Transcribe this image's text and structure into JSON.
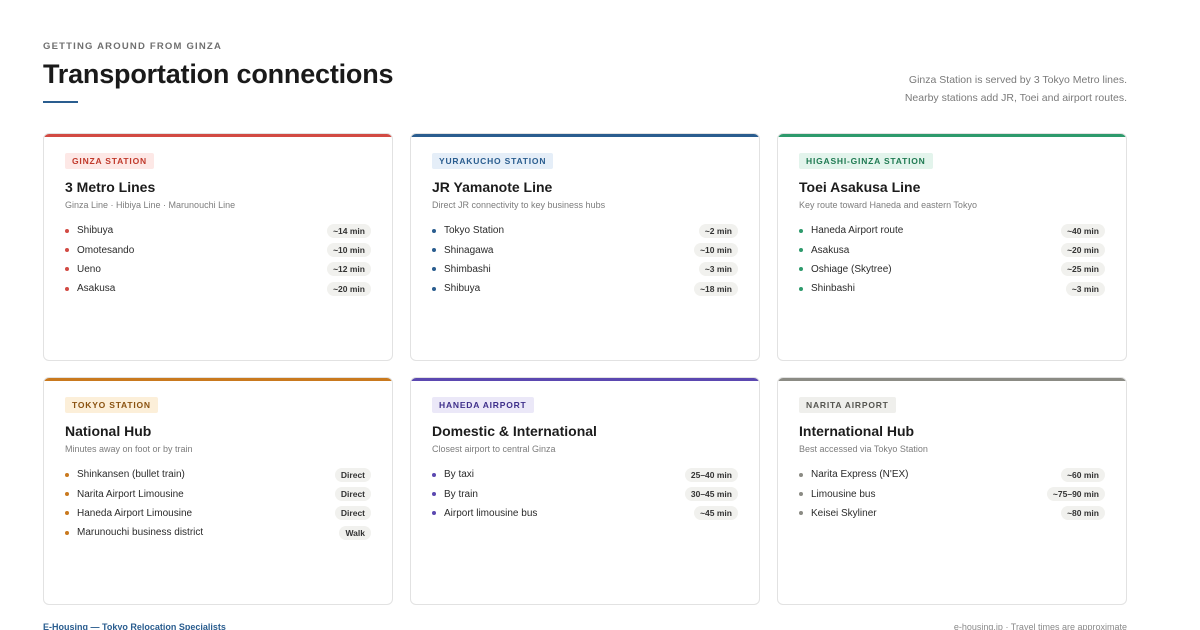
{
  "header": {
    "eyebrow": "GETTING AROUND FROM GINZA",
    "title": "Transportation connections",
    "intro_line1": "Ginza Station is served by 3 Tokyo Metro lines.",
    "intro_line2": "Nearby stations add JR, Toei and airport routes."
  },
  "colors": {
    "accent_rule": "#2a5d8f"
  },
  "cards": [
    {
      "badge": "GINZA STATION",
      "title": "3 Metro Lines",
      "subtitle": "Ginza Line · Hibiya Line · Marunouchi Line",
      "accent": "#d24a43",
      "badge_bg": "#fde8e6",
      "badge_fg": "#c0392b",
      "routes": [
        {
          "name": "Shibuya",
          "time": "~14 min"
        },
        {
          "name": "Omotesando",
          "time": "~10 min"
        },
        {
          "name": "Ueno",
          "time": "~12 min"
        },
        {
          "name": "Asakusa",
          "time": "~20 min"
        }
      ]
    },
    {
      "badge": "YURAKUCHO STATION",
      "title": "JR Yamanote Line",
      "subtitle": "Direct JR connectivity to key business hubs",
      "accent": "#2a5d8f",
      "badge_bg": "#e5eef8",
      "badge_fg": "#2a5d8f",
      "routes": [
        {
          "name": "Tokyo Station",
          "time": "~2 min"
        },
        {
          "name": "Shinagawa",
          "time": "~10 min"
        },
        {
          "name": "Shimbashi",
          "time": "~3 min"
        },
        {
          "name": "Shibuya",
          "time": "~18 min"
        }
      ]
    },
    {
      "badge": "HIGASHI-GINZA STATION",
      "title": "Toei Asakusa Line",
      "subtitle": "Key route toward Haneda and eastern Tokyo",
      "accent": "#2e9a6c",
      "badge_bg": "#e3f4ec",
      "badge_fg": "#1f7a52",
      "routes": [
        {
          "name": "Haneda Airport route",
          "time": "~40 min"
        },
        {
          "name": "Asakusa",
          "time": "~20 min"
        },
        {
          "name": "Oshiage (Skytree)",
          "time": "~25 min"
        },
        {
          "name": "Shinbashi",
          "time": "~3 min"
        }
      ]
    },
    {
      "badge": "TOKYO STATION",
      "title": "National Hub",
      "subtitle": "Minutes away on foot or by train",
      "accent": "#c9791e",
      "badge_bg": "#fcefd9",
      "badge_fg": "#8a5210",
      "routes": [
        {
          "name": "Shinkansen (bullet train)",
          "time": "Direct"
        },
        {
          "name": "Narita Airport Limousine",
          "time": "Direct"
        },
        {
          "name": "Haneda Airport Limousine",
          "time": "Direct"
        },
        {
          "name": "Marunouchi business district",
          "time": "Walk"
        }
      ]
    },
    {
      "badge": "HANEDA AIRPORT",
      "title": "Domestic & International",
      "subtitle": "Closest airport to central Ginza",
      "accent": "#5b48b0",
      "badge_bg": "#ebe8f8",
      "badge_fg": "#3e2f8a",
      "routes": [
        {
          "name": "By taxi",
          "time": "25–40 min"
        },
        {
          "name": "By train",
          "time": "30–45 min"
        },
        {
          "name": "Airport limousine bus",
          "time": "~45 min"
        }
      ]
    },
    {
      "badge": "NARITA AIRPORT",
      "title": "International Hub",
      "subtitle": "Best accessed via Tokyo Station",
      "accent": "#8b8b84",
      "badge_bg": "#efefec",
      "badge_fg": "#555550",
      "routes": [
        {
          "name": "Narita Express (N'EX)",
          "time": "~60 min"
        },
        {
          "name": "Limousine bus",
          "time": "~75–90 min"
        },
        {
          "name": "Keisei Skyliner",
          "time": "~80 min"
        }
      ]
    }
  ],
  "footer": {
    "left": "E-Housing — Tokyo Relocation Specialists",
    "right": "e-housing.jp · Travel times are approximate"
  }
}
